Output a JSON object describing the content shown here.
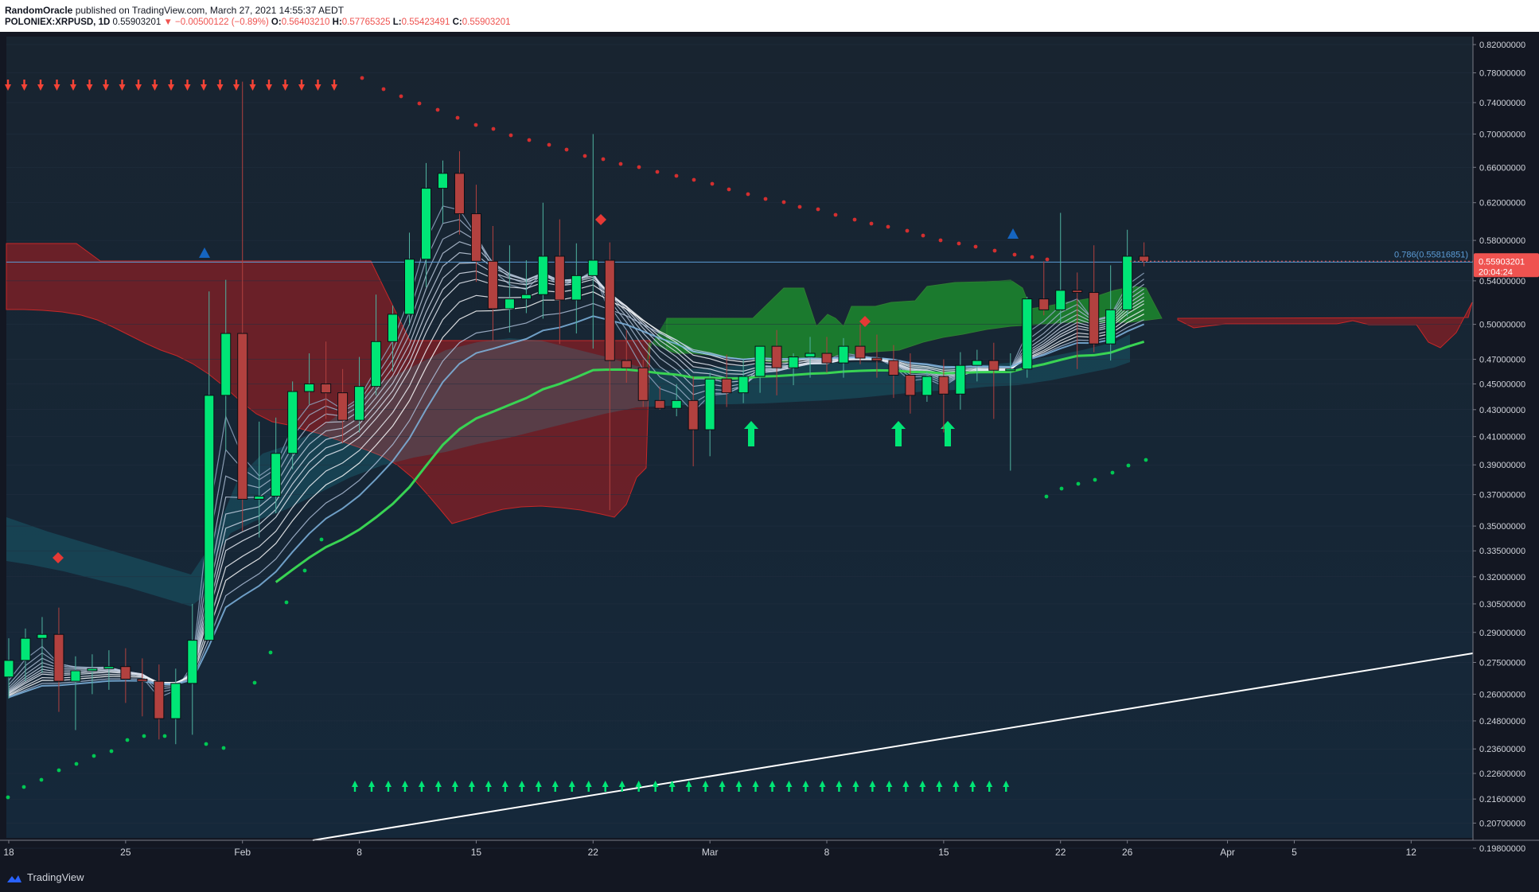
{
  "header": {
    "author": "RandomOracle",
    "published_text": "published on TradingView.com, March 27, 2021 14:55:37 AEDT",
    "symbol": "POLONIEX:XRPUSD, 1D",
    "last": "0.55903201",
    "change": "−0.00500122 (−0.89%)",
    "o_label": "O:",
    "o": "0.56403210",
    "h_label": "H:",
    "h": "0.57765325",
    "l_label": "L:",
    "l": "0.55423491",
    "c_label": "C:",
    "c": "0.55903201"
  },
  "footer": {
    "brand": "TradingView"
  },
  "colors": {
    "background": "#131722",
    "bull": "#00e676",
    "bear": "#b2413f",
    "price_tag": "#ef5350",
    "cloud_bear": "#8b1e24",
    "cloud_bull": "#1fae2b",
    "fib_line": "#5b9bd5"
  },
  "chart_data": {
    "type": "candlestick",
    "symbol": "POLONIEX:XRPUSD",
    "interval": "1D",
    "y_scale": "log",
    "ylim": [
      0.19,
      0.82
    ],
    "y_ticks": [
      "0.82000000",
      "0.78000000",
      "0.74000000",
      "0.70000000",
      "0.66000000",
      "0.62000000",
      "0.58000000",
      "0.54000000",
      "0.50000000",
      "0.47000000",
      "0.45000000",
      "0.43000000",
      "0.41000000",
      "0.39000000",
      "0.37000000",
      "0.35000000",
      "0.33500000",
      "0.32000000",
      "0.30500000",
      "0.29000000",
      "0.27500000",
      "0.26000000",
      "0.24800000",
      "0.23600000",
      "0.22600000",
      "0.21600000",
      "0.20700000",
      "0.19800000"
    ],
    "x_ticks": [
      {
        "label": "18",
        "date": "2021-01-18"
      },
      {
        "label": "25",
        "date": "2021-01-25"
      },
      {
        "label": "Feb",
        "date": "2021-02-01"
      },
      {
        "label": "8",
        "date": "2021-02-08"
      },
      {
        "label": "15",
        "date": "2021-02-15"
      },
      {
        "label": "22",
        "date": "2021-02-22"
      },
      {
        "label": "Mar",
        "date": "2021-03-01"
      },
      {
        "label": "8",
        "date": "2021-03-08"
      },
      {
        "label": "15",
        "date": "2021-03-15"
      },
      {
        "label": "22",
        "date": "2021-03-22"
      },
      {
        "label": "26",
        "date": "2021-03-26"
      },
      {
        "label": "Apr",
        "date": "2021-04-01"
      },
      {
        "label": "5",
        "date": "2021-04-05"
      },
      {
        "label": "12",
        "date": "2021-04-12"
      }
    ],
    "fib_level": {
      "label": "0.786(0.55816851)",
      "value": 0.55816851
    },
    "last_price": {
      "value": "0.55903201",
      "countdown": "20:04:24"
    },
    "candles": [
      [
        "2021-01-18",
        0.268,
        0.287,
        0.258,
        0.276
      ],
      [
        "2021-01-19",
        0.276,
        0.292,
        0.266,
        0.287
      ],
      [
        "2021-01-20",
        0.287,
        0.298,
        0.27,
        0.289
      ],
      [
        "2021-01-21",
        0.289,
        0.303,
        0.252,
        0.266
      ],
      [
        "2021-01-22",
        0.266,
        0.278,
        0.244,
        0.271
      ],
      [
        "2021-01-23",
        0.271,
        0.279,
        0.26,
        0.272
      ],
      [
        "2021-01-24",
        0.272,
        0.281,
        0.262,
        0.273
      ],
      [
        "2021-01-25",
        0.273,
        0.282,
        0.256,
        0.267
      ],
      [
        "2021-01-26",
        0.267,
        0.277,
        0.25,
        0.266
      ],
      [
        "2021-01-27",
        0.266,
        0.274,
        0.24,
        0.249
      ],
      [
        "2021-01-28",
        0.249,
        0.272,
        0.238,
        0.265
      ],
      [
        "2021-01-29",
        0.265,
        0.305,
        0.242,
        0.286
      ],
      [
        "2021-01-30",
        0.286,
        0.53,
        0.286,
        0.441
      ],
      [
        "2021-01-31",
        0.441,
        0.541,
        0.4,
        0.492
      ],
      [
        "2021-02-01",
        0.492,
        0.768,
        0.347,
        0.367
      ],
      [
        "2021-02-02",
        0.367,
        0.421,
        0.343,
        0.369
      ],
      [
        "2021-02-03",
        0.369,
        0.424,
        0.358,
        0.398
      ],
      [
        "2021-02-04",
        0.398,
        0.452,
        0.387,
        0.444
      ],
      [
        "2021-02-05",
        0.444,
        0.475,
        0.434,
        0.45
      ],
      [
        "2021-02-06",
        0.45,
        0.485,
        0.423,
        0.443
      ],
      [
        "2021-02-07",
        0.443,
        0.462,
        0.405,
        0.422
      ],
      [
        "2021-02-08",
        0.422,
        0.472,
        0.413,
        0.448
      ],
      [
        "2021-02-09",
        0.448,
        0.527,
        0.441,
        0.485
      ],
      [
        "2021-02-10",
        0.485,
        0.517,
        0.46,
        0.509
      ],
      [
        "2021-02-11",
        0.509,
        0.588,
        0.499,
        0.561
      ],
      [
        "2021-02-12",
        0.561,
        0.665,
        0.534,
        0.636
      ],
      [
        "2021-02-13",
        0.636,
        0.668,
        0.598,
        0.653
      ],
      [
        "2021-02-14",
        0.653,
        0.679,
        0.586,
        0.608
      ],
      [
        "2021-02-15",
        0.608,
        0.64,
        0.539,
        0.559
      ],
      [
        "2021-02-16",
        0.559,
        0.595,
        0.486,
        0.514
      ],
      [
        "2021-02-17",
        0.514,
        0.575,
        0.493,
        0.523
      ],
      [
        "2021-02-18",
        0.523,
        0.56,
        0.51,
        0.527
      ],
      [
        "2021-02-19",
        0.527,
        0.62,
        0.505,
        0.564
      ],
      [
        "2021-02-20",
        0.564,
        0.602,
        0.483,
        0.522
      ],
      [
        "2021-02-21",
        0.522,
        0.577,
        0.492,
        0.545
      ],
      [
        "2021-02-22",
        0.545,
        0.7,
        0.479,
        0.56
      ],
      [
        "2021-02-23",
        0.56,
        0.578,
        0.36,
        0.469
      ],
      [
        "2021-02-24",
        0.469,
        0.495,
        0.451,
        0.463
      ],
      [
        "2021-02-25",
        0.463,
        0.47,
        0.432,
        0.437
      ],
      [
        "2021-02-26",
        0.437,
        0.448,
        0.43,
        0.431
      ],
      [
        "2021-02-27",
        0.431,
        0.45,
        0.425,
        0.437
      ],
      [
        "2021-02-28",
        0.437,
        0.456,
        0.389,
        0.415
      ],
      [
        "2021-03-01",
        0.415,
        0.459,
        0.396,
        0.454
      ],
      [
        "2021-03-02",
        0.454,
        0.474,
        0.432,
        0.443
      ],
      [
        "2021-03-03",
        0.443,
        0.47,
        0.435,
        0.456
      ],
      [
        "2021-03-04",
        0.456,
        0.478,
        0.443,
        0.481
      ],
      [
        "2021-03-05",
        0.481,
        0.495,
        0.441,
        0.463
      ],
      [
        "2021-03-06",
        0.463,
        0.475,
        0.449,
        0.472
      ],
      [
        "2021-03-07",
        0.472,
        0.489,
        0.455,
        0.475
      ],
      [
        "2021-03-08",
        0.475,
        0.489,
        0.459,
        0.467
      ],
      [
        "2021-03-09",
        0.467,
        0.488,
        0.455,
        0.481
      ],
      [
        "2021-03-10",
        0.481,
        0.5,
        0.466,
        0.471
      ],
      [
        "2021-03-11",
        0.471,
        0.491,
        0.455,
        0.469
      ],
      [
        "2021-03-12",
        0.469,
        0.482,
        0.439,
        0.457
      ],
      [
        "2021-03-13",
        0.457,
        0.475,
        0.427,
        0.441
      ],
      [
        "2021-03-14",
        0.441,
        0.46,
        0.436,
        0.456
      ],
      [
        "2021-03-15",
        0.456,
        0.47,
        0.413,
        0.442
      ],
      [
        "2021-03-16",
        0.442,
        0.476,
        0.43,
        0.465
      ],
      [
        "2021-03-17",
        0.465,
        0.478,
        0.452,
        0.469
      ],
      [
        "2021-03-18",
        0.469,
        0.484,
        0.423,
        0.461
      ],
      [
        "2021-03-19",
        0.461,
        0.475,
        0.386,
        0.462
      ],
      [
        "2021-03-20",
        0.462,
        0.525,
        0.455,
        0.523
      ],
      [
        "2021-03-21",
        0.523,
        0.559,
        0.508,
        0.513
      ],
      [
        "2021-03-22",
        0.513,
        0.609,
        0.501,
        0.531
      ],
      [
        "2021-03-23",
        0.531,
        0.548,
        0.462,
        0.529
      ],
      [
        "2021-03-24",
        0.529,
        0.575,
        0.476,
        0.483
      ],
      [
        "2021-03-25",
        0.483,
        0.555,
        0.469,
        0.513
      ],
      [
        "2021-03-26",
        0.513,
        0.591,
        0.507,
        0.564
      ],
      [
        "2021-03-27",
        0.564,
        0.578,
        0.554,
        0.559
      ]
    ]
  }
}
